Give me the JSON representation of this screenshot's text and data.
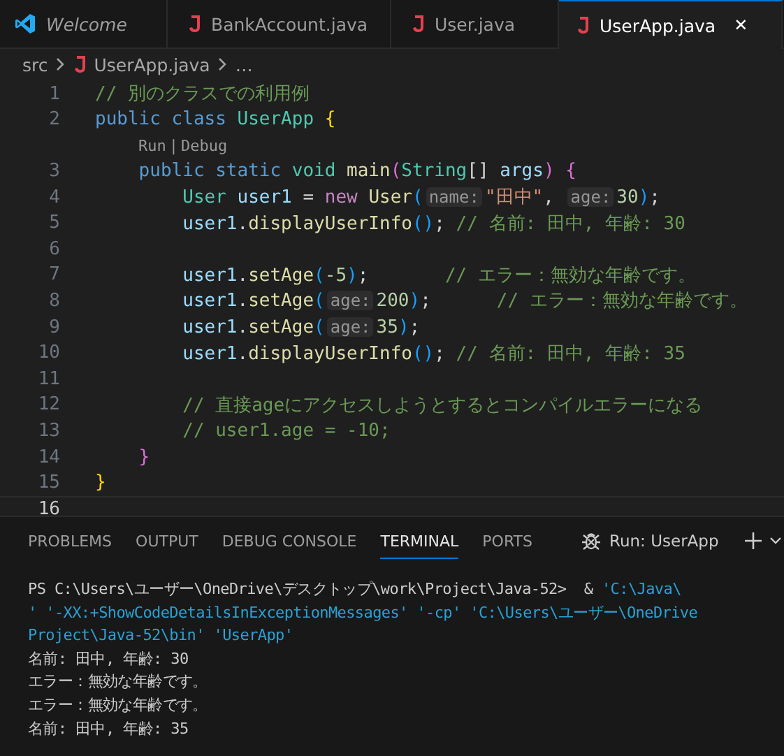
{
  "editor_tabs": [
    {
      "label": "Welcome",
      "kind": "welcome",
      "italic": true,
      "selected": false
    },
    {
      "label": "BankAccount.java",
      "kind": "file",
      "italic": false,
      "selected": false
    },
    {
      "label": "User.java",
      "kind": "file",
      "italic": false,
      "selected": false
    },
    {
      "label": "UserApp.java",
      "kind": "file",
      "italic": false,
      "selected": true,
      "close": "✕"
    }
  ],
  "breadcrumb": {
    "folder": "src",
    "file": "UserApp.java",
    "more": "…"
  },
  "code_lines": [
    {
      "kind": "code",
      "number": "1",
      "current": false,
      "tokens": [
        {
          "kind": "comment",
          "text": "// 別のクラスでの利用例"
        }
      ]
    },
    {
      "kind": "code",
      "number": "2",
      "current": false,
      "tokens": [
        {
          "kind": "keyword",
          "text": "public class "
        },
        {
          "kind": "type",
          "text": "UserApp "
        },
        {
          "kind": "bracket1",
          "text": "{"
        }
      ]
    },
    {
      "kind": "codelens",
      "links": [
        "Run",
        "Debug"
      ],
      "separator": "|"
    },
    {
      "kind": "code",
      "number": "3",
      "current": false,
      "tokens": [
        {
          "kind": "keyword",
          "text": "    public static "
        },
        {
          "kind": "type",
          "text": "void "
        },
        {
          "kind": "func",
          "text": "main"
        },
        {
          "kind": "bracket2",
          "text": "("
        },
        {
          "kind": "type",
          "text": "String"
        },
        {
          "kind": "plain",
          "text": "[] "
        },
        {
          "kind": "var",
          "text": "args"
        },
        {
          "kind": "bracket2",
          "text": ") {"
        }
      ]
    },
    {
      "kind": "code",
      "number": "4",
      "current": false,
      "tokens": [
        {
          "kind": "type",
          "text": "        User "
        },
        {
          "kind": "var",
          "text": "user1"
        },
        {
          "kind": "plain",
          "text": " = "
        },
        {
          "kind": "control",
          "text": "new "
        },
        {
          "kind": "func",
          "text": "User"
        },
        {
          "kind": "bracket3",
          "text": "("
        },
        {
          "kind": "hint",
          "text": "name:"
        },
        {
          "kind": "string",
          "text": "\"田中\""
        },
        {
          "kind": "plain",
          "text": ", "
        },
        {
          "kind": "hint",
          "text": "age:"
        },
        {
          "kind": "number",
          "text": "30"
        },
        {
          "kind": "bracket3",
          "text": ")"
        },
        {
          "kind": "plain",
          "text": ";"
        }
      ]
    },
    {
      "kind": "code",
      "number": "5",
      "current": false,
      "tokens": [
        {
          "kind": "var",
          "text": "        user1"
        },
        {
          "kind": "plain",
          "text": "."
        },
        {
          "kind": "func",
          "text": "displayUserInfo"
        },
        {
          "kind": "bracket3",
          "text": "()"
        },
        {
          "kind": "plain",
          "text": "; "
        },
        {
          "kind": "comment",
          "text": "// 名前: 田中, 年齢: 30"
        }
      ]
    },
    {
      "kind": "code",
      "number": "6",
      "current": false
    },
    {
      "kind": "code",
      "number": "7",
      "current": false,
      "tokens": [
        {
          "kind": "var",
          "text": "        user1"
        },
        {
          "kind": "plain",
          "text": "."
        },
        {
          "kind": "func",
          "text": "setAge"
        },
        {
          "kind": "bracket3",
          "text": "("
        },
        {
          "kind": "number",
          "text": "-5"
        },
        {
          "kind": "bracket3",
          "text": ")"
        },
        {
          "kind": "plain",
          "text": ";       "
        },
        {
          "kind": "comment",
          "text": "// エラー：無効な年齢です。"
        }
      ]
    },
    {
      "kind": "code",
      "number": "8",
      "current": false,
      "tokens": [
        {
          "kind": "var",
          "text": "        user1"
        },
        {
          "kind": "plain",
          "text": "."
        },
        {
          "kind": "func",
          "text": "setAge"
        },
        {
          "kind": "bracket3",
          "text": "("
        },
        {
          "kind": "hint",
          "text": "age:"
        },
        {
          "kind": "number",
          "text": "200"
        },
        {
          "kind": "bracket3",
          "text": ")"
        },
        {
          "kind": "plain",
          "text": ";      "
        },
        {
          "kind": "comment",
          "text": "// エラー：無効な年齢です。"
        }
      ]
    },
    {
      "kind": "code",
      "number": "9",
      "current": false,
      "tokens": [
        {
          "kind": "var",
          "text": "        user1"
        },
        {
          "kind": "plain",
          "text": "."
        },
        {
          "kind": "func",
          "text": "setAge"
        },
        {
          "kind": "bracket3",
          "text": "("
        },
        {
          "kind": "hint",
          "text": "age:"
        },
        {
          "kind": "number",
          "text": "35"
        },
        {
          "kind": "bracket3",
          "text": ")"
        },
        {
          "kind": "plain",
          "text": ";"
        }
      ]
    },
    {
      "kind": "code",
      "number": "10",
      "current": false,
      "tokens": [
        {
          "kind": "var",
          "text": "        user1"
        },
        {
          "kind": "plain",
          "text": "."
        },
        {
          "kind": "func",
          "text": "displayUserInfo"
        },
        {
          "kind": "bracket3",
          "text": "()"
        },
        {
          "kind": "plain",
          "text": "; "
        },
        {
          "kind": "comment",
          "text": "// 名前: 田中, 年齢: 35"
        }
      ]
    },
    {
      "kind": "code",
      "number": "11",
      "current": false
    },
    {
      "kind": "code",
      "number": "12",
      "current": false,
      "tokens": [
        {
          "kind": "comment",
          "text": "        // 直接ageにアクセスしようとするとコンパイルエラーになる"
        }
      ]
    },
    {
      "kind": "code",
      "number": "13",
      "current": false,
      "tokens": [
        {
          "kind": "comment",
          "text": "        // user1.age = -10;"
        }
      ]
    },
    {
      "kind": "code",
      "number": "14",
      "current": false,
      "tokens": [
        {
          "kind": "bracket2",
          "text": "    }"
        }
      ]
    },
    {
      "kind": "code",
      "number": "15",
      "current": false,
      "tokens": [
        {
          "kind": "bracket1",
          "text": "}"
        }
      ]
    },
    {
      "kind": "code",
      "number": "16",
      "current": true
    }
  ],
  "panel_tabs": [
    {
      "label": "PROBLEMS",
      "selected": false
    },
    {
      "label": "OUTPUT",
      "selected": false
    },
    {
      "label": "DEBUG CONSOLE",
      "selected": false
    },
    {
      "label": "TERMINAL",
      "selected": true
    },
    {
      "label": "PORTS",
      "selected": false
    }
  ],
  "run_config": "Run: UserApp",
  "terminal_lines": [
    [
      {
        "kind": "output",
        "text": "PS C:\\Users\\ユーザー\\OneDrive\\デスクトップ\\work\\Project\\Java-52>  & "
      },
      {
        "kind": "arg",
        "text": "'C:\\Java\\"
      }
    ],
    [
      {
        "kind": "arg",
        "text": "' '-XX:+ShowCodeDetailsInExceptionMessages' '-cp' 'C:\\Users\\ユーザー\\OneDrive"
      }
    ],
    [
      {
        "kind": "arg",
        "text": "Project\\Java-52\\bin' 'UserApp'"
      }
    ],
    [
      {
        "kind": "output",
        "text": "名前: 田中, 年齢: 30"
      }
    ],
    [
      {
        "kind": "output",
        "text": "エラー：無効な年齢です。"
      }
    ],
    [
      {
        "kind": "output",
        "text": "エラー：無効な年齢です。"
      }
    ],
    [
      {
        "kind": "output",
        "text": "名前: 田中, 年齢: 35"
      }
    ]
  ]
}
